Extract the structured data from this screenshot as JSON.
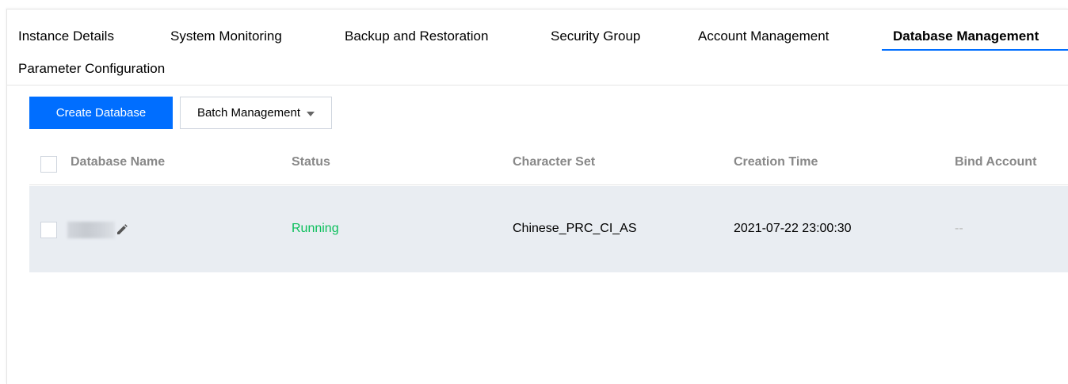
{
  "tabs": [
    {
      "label": "Instance Details",
      "active": false
    },
    {
      "label": "System Monitoring",
      "active": false
    },
    {
      "label": "Backup and Restoration",
      "active": false
    },
    {
      "label": "Security Group",
      "active": false
    },
    {
      "label": "Account Management",
      "active": false
    },
    {
      "label": "Database Management",
      "active": true
    },
    {
      "label": "Parameter Configuration",
      "active": false
    }
  ],
  "toolbar": {
    "create_label": "Create Database",
    "batch_label": "Batch Management"
  },
  "table": {
    "columns": [
      "Database Name",
      "Status",
      "Character Set",
      "Creation Time",
      "Bind Account"
    ],
    "rows": [
      {
        "name": "",
        "status": "Running",
        "charset": "Chinese_PRC_CI_AS",
        "created": "2021-07-22 23:00:30",
        "bind_account": "--"
      }
    ]
  },
  "colors": {
    "accent": "#006eff",
    "running": "#0abf5b",
    "row_highlight": "#e9edf2"
  },
  "icons": {
    "edit": "pencil-icon",
    "dropdown": "caret-down-icon"
  }
}
